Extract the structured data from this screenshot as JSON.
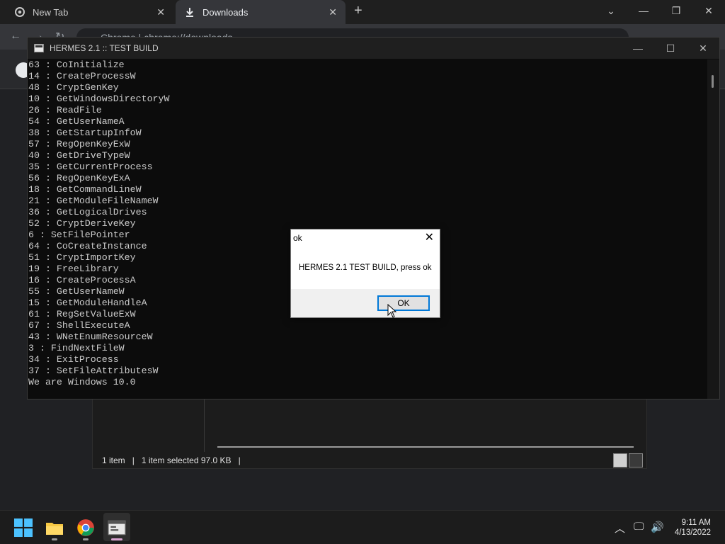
{
  "chrome": {
    "tabs": [
      {
        "label": "New Tab"
      },
      {
        "label": "Downloads"
      }
    ],
    "new_tab_symbol": "+",
    "omnibox_text": "Chrome  |  chrome://downloads",
    "window_controls": {
      "dropdown": "⌄",
      "minimize": "—",
      "restore": "❐",
      "close": "✕"
    }
  },
  "console": {
    "title": "HERMES 2.1 :: TEST BUILD",
    "lines": [
      "63 : CoInitialize",
      "14 : CreateProcessW",
      "48 : CryptGenKey",
      "10 : GetWindowsDirectoryW",
      "26 : ReadFile",
      "54 : GetUserNameA",
      "38 : GetStartupInfoW",
      "57 : RegOpenKeyExW",
      "40 : GetDriveTypeW",
      "35 : GetCurrentProcess",
      "56 : RegOpenKeyExA",
      "18 : GetCommandLineW",
      "21 : GetModuleFileNameW",
      "36 : GetLogicalDrives",
      "52 : CryptDeriveKey",
      "6 : SetFilePointer",
      "64 : CoCreateInstance",
      "51 : CryptImportKey",
      "19 : FreeLibrary",
      "16 : CreateProcessA",
      "55 : GetUserNameW",
      "15 : GetModuleHandleA",
      "61 : RegSetValueExW",
      "67 : ShellExecuteA",
      "43 : WNetEnumResourceW",
      "3 : FindNextFileW",
      "34 : ExitProcess",
      "37 : SetFileAttributesW",
      "We are Windows 10.0"
    ],
    "controls": {
      "minimize": "—",
      "maximize": "☐",
      "close": "✕"
    }
  },
  "dialog": {
    "title": "ok",
    "message": "HERMES 2.1 TEST BUILD, press ok",
    "ok_label": "OK",
    "close_symbol": "✕"
  },
  "explorer": {
    "item_count": "1 item",
    "selection": "1 item selected  97.0 KB"
  },
  "taskbar": {
    "time": "9:11 AM",
    "date": "4/13/2022",
    "icons": [
      "start-icon",
      "file-explorer-icon",
      "chrome-icon",
      "console-app-icon"
    ]
  },
  "colors": {
    "console_bg": "#0c0c0c",
    "console_text": "#cccccc",
    "dialog_button_border": "#0078d7",
    "taskbar_bg": "#1c1c1c"
  }
}
